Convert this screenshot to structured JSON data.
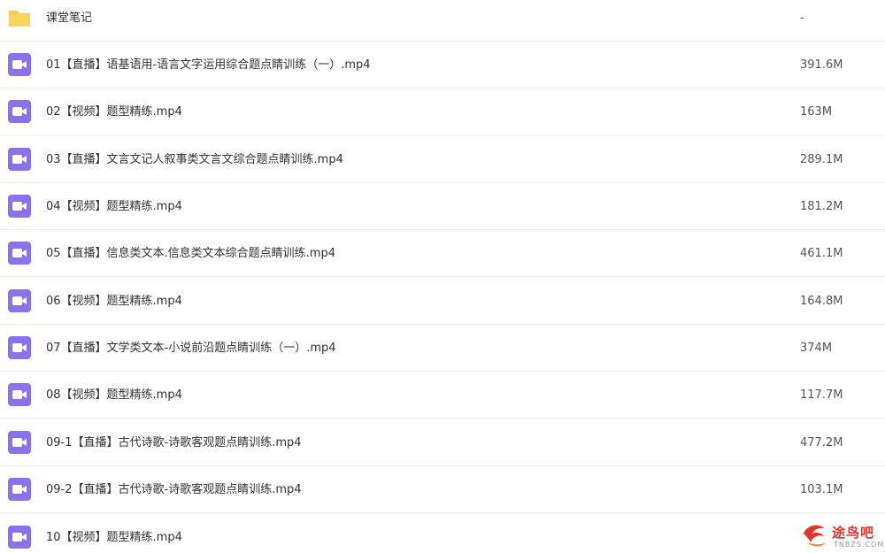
{
  "colors": {
    "folder": "#f9c94e",
    "video_icon": "#8a73ea",
    "watermark": "#e8342a"
  },
  "files": [
    {
      "icon": "folder-icon",
      "name": "课堂笔记",
      "size": "-"
    },
    {
      "icon": "video-file-icon",
      "name": "01【直播】语基语用-语言文字运用综合题点睛训练（一）.mp4",
      "size": "391.6M"
    },
    {
      "icon": "video-file-icon",
      "name": "02【视频】题型精练.mp4",
      "size": "163M"
    },
    {
      "icon": "video-file-icon",
      "name": "03【直播】文言文记人叙事类文言文综合题点睛训练.mp4",
      "size": "289.1M"
    },
    {
      "icon": "video-file-icon",
      "name": "04【视频】题型精练.mp4",
      "size": "181.2M"
    },
    {
      "icon": "video-file-icon",
      "name": "05【直播】信息类文本.信息类文本综合题点睛训练.mp4",
      "size": "461.1M"
    },
    {
      "icon": "video-file-icon",
      "name": "06【视频】题型精练.mp4",
      "size": "164.8M"
    },
    {
      "icon": "video-file-icon",
      "name": "07【直播】文学类文本-小说前沿题点睛训练（一）.mp4",
      "size": "374M"
    },
    {
      "icon": "video-file-icon",
      "name": "08【视频】题型精练.mp4",
      "size": "117.7M"
    },
    {
      "icon": "video-file-icon",
      "name": "09-1【直播】古代诗歌-诗歌客观题点睛训练.mp4",
      "size": "477.2M"
    },
    {
      "icon": "video-file-icon",
      "name": "09-2【直播】古代诗歌-诗歌客观题点睛训练.mp4",
      "size": "103.1M"
    },
    {
      "icon": "video-file-icon",
      "name": "10【视频】题型精练.mp4",
      "size": ""
    }
  ],
  "watermark": {
    "title": "途鸟吧",
    "subtitle": "TNBZS.COM"
  }
}
